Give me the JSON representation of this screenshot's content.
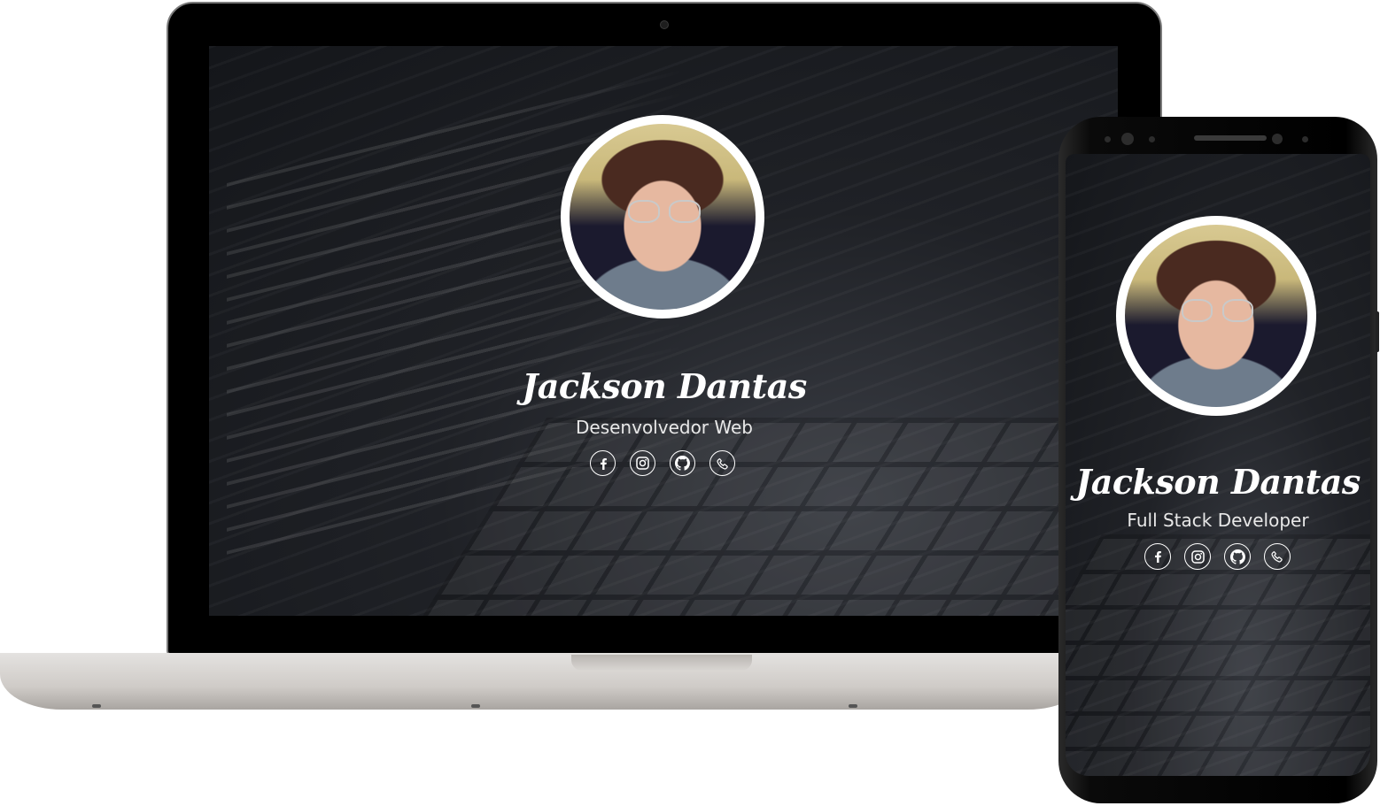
{
  "laptop": {
    "profile": {
      "name": "Jackson Dantas",
      "role": "Desenvolvedor Web",
      "social": [
        {
          "icon": "facebook-icon"
        },
        {
          "icon": "instagram-icon"
        },
        {
          "icon": "github-icon"
        },
        {
          "icon": "phone-icon"
        }
      ]
    }
  },
  "phone": {
    "profile": {
      "name": "Jackson Dantas",
      "role": "Full Stack Developer",
      "social": [
        {
          "icon": "facebook-icon"
        },
        {
          "icon": "instagram-icon"
        },
        {
          "icon": "github-icon"
        },
        {
          "icon": "phone-icon"
        }
      ]
    }
  },
  "colors": {
    "text": "#ffffff",
    "background": "#1c1e22",
    "laptop_body": "#d4d0cc",
    "device_frame": "#000000"
  }
}
